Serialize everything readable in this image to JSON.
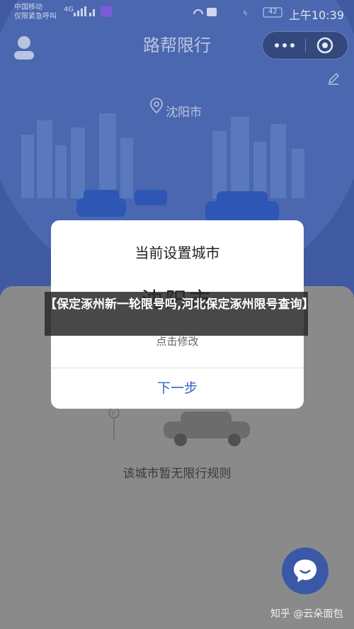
{
  "status_bar": {
    "carrier_line1": "中国移动",
    "carrier_line2": "仅限紧急呼叫",
    "network": "4G",
    "battery": "42",
    "time": "上午10:39"
  },
  "header": {
    "title": "路帮限行"
  },
  "city_row": {
    "city": "沈阳市"
  },
  "dialog": {
    "title": "当前设置城市",
    "city": "沈阳市",
    "hint": "点击修改",
    "next_label": "下一步"
  },
  "banner": {
    "text": "【保定涿州新一轮限号吗,河北保定涿州限号查询】"
  },
  "content": {
    "no_rule_text": "该城市暂无限行规则"
  },
  "watermark": "知乎 @云朵面包",
  "colors": {
    "hero_bg": "#3f5aa0",
    "accent_blue": "#2e63c7",
    "chat_button": "#3b58a6"
  }
}
